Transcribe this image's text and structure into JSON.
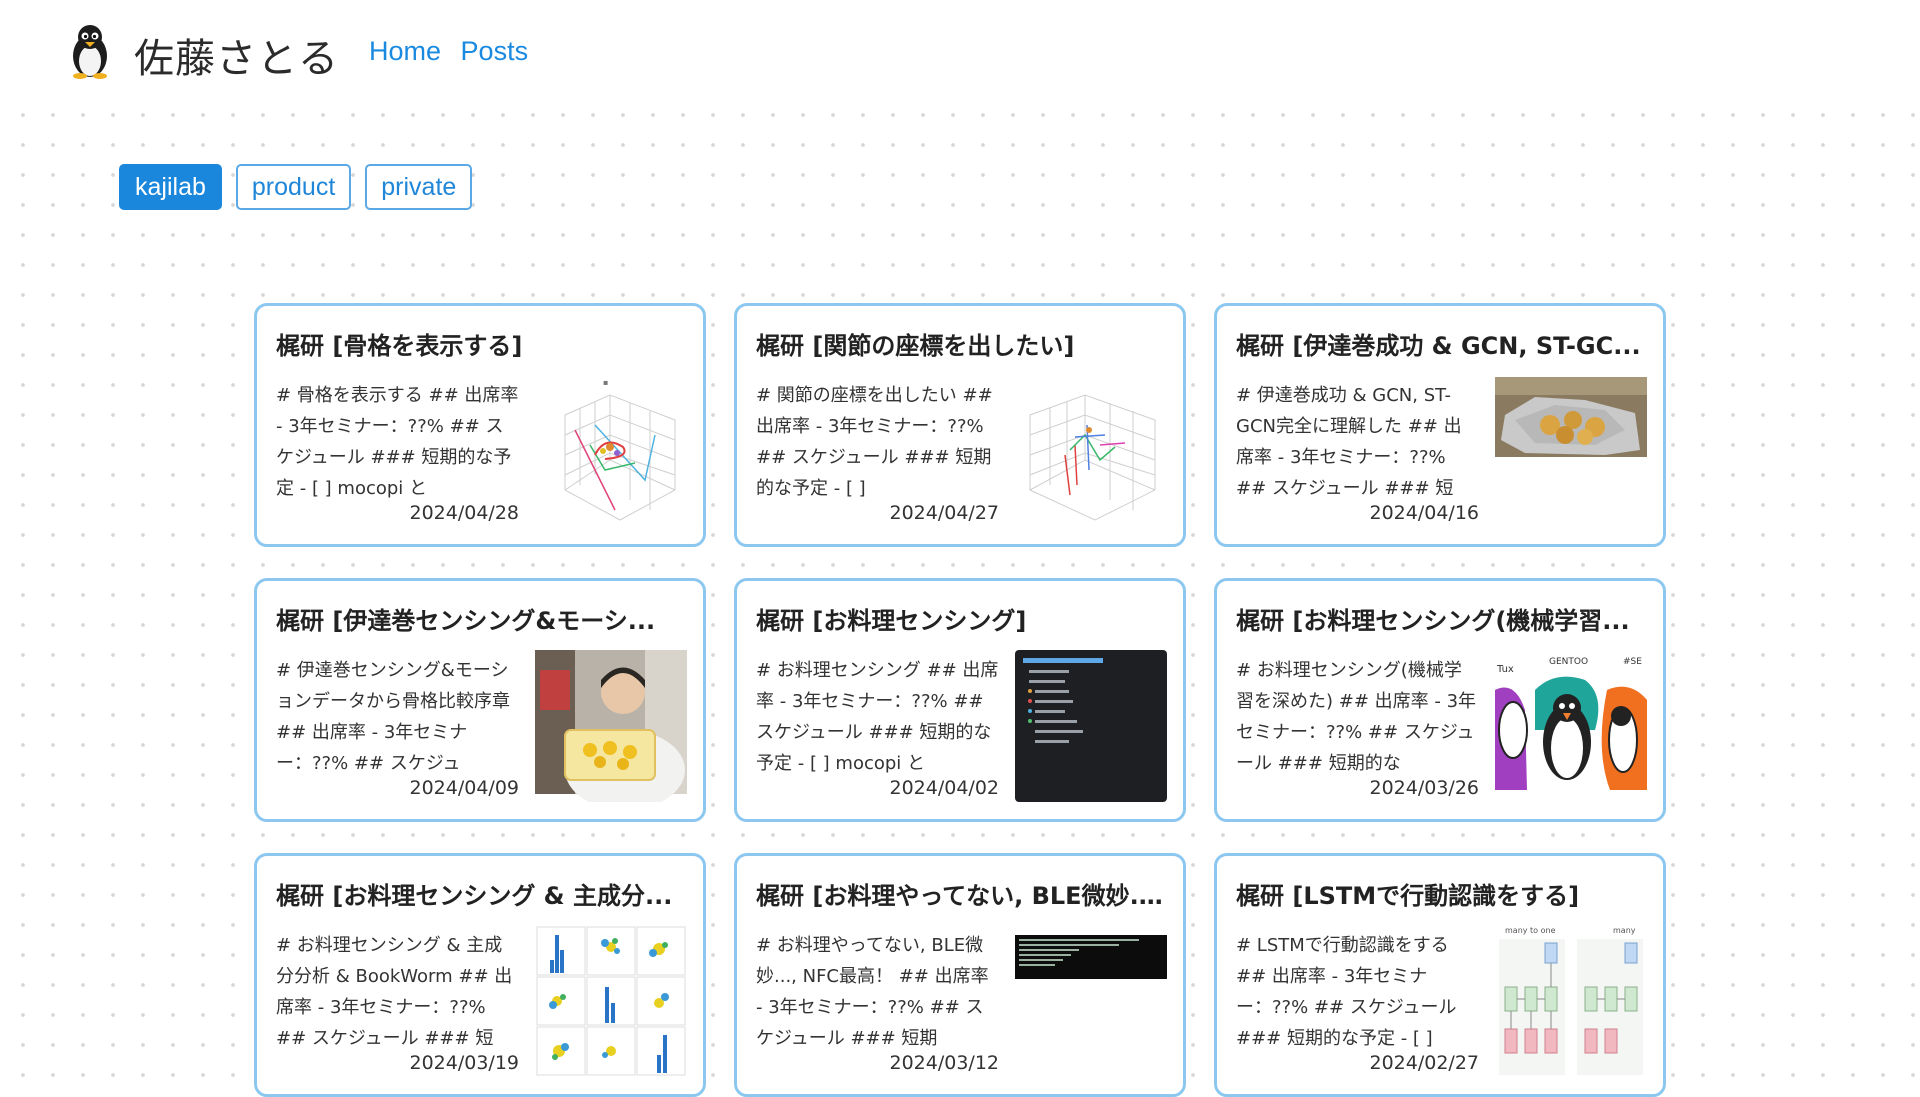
{
  "header": {
    "site_title": "佐藤さとる",
    "nav": [
      "Home",
      "Posts"
    ]
  },
  "tags": [
    {
      "label": "kajilab",
      "active": true
    },
    {
      "label": "product",
      "active": false
    },
    {
      "label": "private",
      "active": false
    }
  ],
  "posts": [
    {
      "title": "梶研 [骨格を表示する]",
      "excerpt": "# 骨格を表示する ## 出席率 - 3年セミナー：??% ## スケジュール ### 短期的な予定 - [ ] mocopi と",
      "date": "2024/04/28",
      "thumb_icon": "3d-skeleton-plot-image"
    },
    {
      "title": "梶研 [関節の座標を出したい]",
      "excerpt": "# 関節の座標を出したい ## 出席率 - 3年セミナー：??% ## スケジュール ### 短期的な予定 - [ ]",
      "date": "2024/04/27",
      "thumb_icon": "3d-joint-plot-image"
    },
    {
      "title": "梶研 [伊達巻成功 & GCN, ST-GC...",
      "excerpt": "# 伊達巻成功 & GCN, ST-GCN完全に理解した ## 出席率 - 3年セミナー：??% ## スケジュール ### 短",
      "date": "2024/04/16",
      "thumb_icon": "food-photo-image"
    },
    {
      "title": "梶研 [伊達巻センシング&モーシ...",
      "excerpt": "# 伊達巻センシング&モーションデータから骨格比較序章 ## 出席率 - 3年セミナー：??% ## スケジュ",
      "date": "2024/04/09",
      "thumb_icon": "person-photo-image"
    },
    {
      "title": "梶研 [お料理センシング]",
      "excerpt": "# お料理センシング ## 出席率 - 3年セミナー：??% ## スケジュール ### 短期的な予定 - [ ] mocopi と",
      "date": "2024/04/02",
      "thumb_icon": "code-editor-image"
    },
    {
      "title": "梶研 [お料理センシング(機械学習...",
      "excerpt": "# お料理センシング(機械学習を深めた) ## 出席率 - 3年セミナー：??% ## スケジュール ### 短期的な",
      "date": "2024/03/26",
      "thumb_icon": "penguin-illustration-image"
    },
    {
      "title": "梶研 [お料理センシング & 主成分...",
      "excerpt": "# お料理センシング & 主成分分析 & BookWorm ## 出席率 - 3年セミナー：??% ## スケジュール ### 短",
      "date": "2024/03/19",
      "thumb_icon": "pairplot-image"
    },
    {
      "title": "梶研 [お料理やってない, BLE微妙....",
      "excerpt": "# お料理やってない, BLE微妙..., NFC最高！ ## 出席率 - 3年セミナー：??% ## スケジュール ### 短期",
      "date": "2024/03/12",
      "thumb_icon": "terminal-screenshot-image"
    },
    {
      "title": "梶研 [LSTMで行動認識をする]",
      "excerpt": "# LSTMで行動認識をする ## 出席率 - 3年セミナー：??% ## スケジュール ### 短期的な予定 - [ ]",
      "date": "2024/02/27",
      "thumb_icon": "lstm-diagram-image"
    }
  ],
  "thumb_text": {
    "lstm_left": "many to one",
    "lstm_right": "many",
    "penguin_left": "Tux",
    "penguin_mid": "GENTOO",
    "penguin_right": "#SE"
  },
  "colors": {
    "accent": "#1a87dc",
    "card_border": "#8cc7f0",
    "dot": "#d7d7d7"
  }
}
